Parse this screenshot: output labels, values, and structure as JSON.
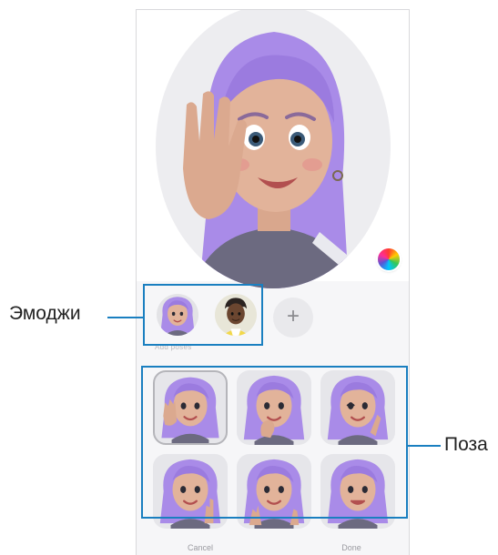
{
  "preview": {
    "avatar_icon": "avatar-waving",
    "palette_icon": "color-palette-icon"
  },
  "emoji_row": {
    "items": [
      {
        "icon": "avatar-purple-hair",
        "selected": true
      },
      {
        "icon": "avatar-dark-hair"
      }
    ],
    "add_label": "+"
  },
  "section_label": "Add poses",
  "poses": [
    {
      "icon": "pose-wave",
      "selected": true
    },
    {
      "icon": "pose-think"
    },
    {
      "icon": "pose-wink"
    },
    {
      "icon": "pose-peace"
    },
    {
      "icon": "pose-kiss"
    },
    {
      "icon": "pose-laugh"
    }
  ],
  "bottom_bar": {
    "cancel_label": "Cancel",
    "done_label": "Done"
  },
  "callouts": {
    "emoji_label": "Эмоджи",
    "pose_label": "Поза"
  },
  "colors": {
    "callout": "#1a7fc0",
    "hair": "#a98be8",
    "skin": "#e2b39a",
    "shirt": "#6c6a80"
  }
}
